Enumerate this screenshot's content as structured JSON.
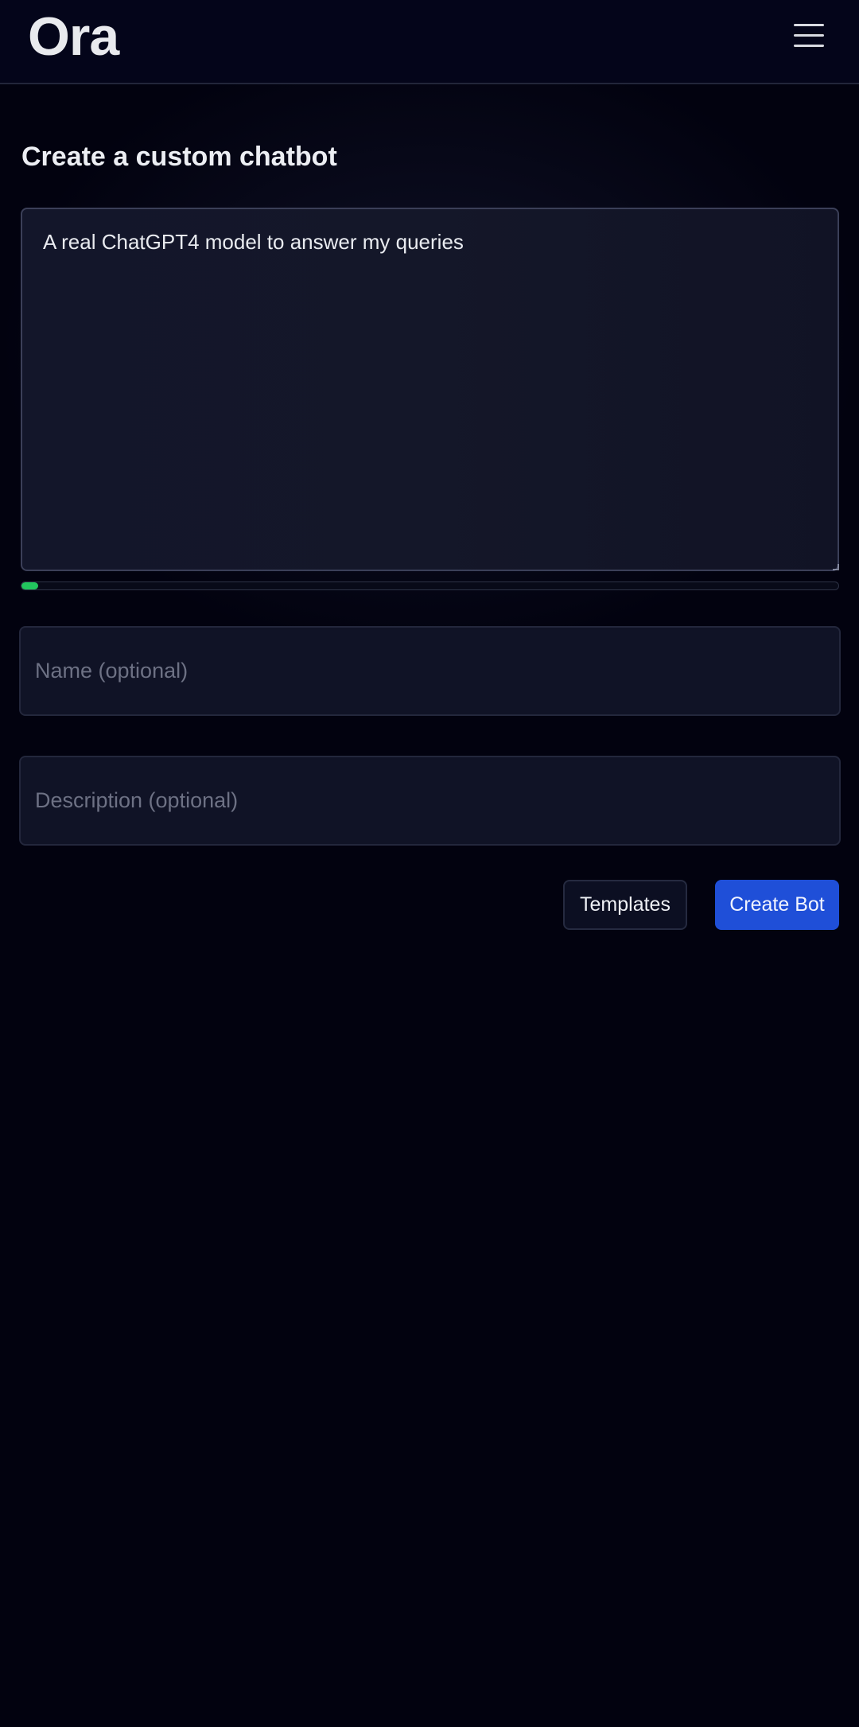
{
  "header": {
    "logo": "Ora",
    "menu_icon": "hamburger-menu-icon"
  },
  "main": {
    "title": "Create a custom chatbot",
    "prompt": {
      "value": "A real ChatGPT4 model to answer my queries"
    },
    "progress": {
      "fraction": 0.02,
      "color": "#22c55e"
    },
    "name_field": {
      "placeholder": "Name (optional)",
      "value": ""
    },
    "description_field": {
      "placeholder": "Description (optional)",
      "value": ""
    },
    "buttons": {
      "templates_label": "Templates",
      "create_label": "Create Bot"
    }
  },
  "colors": {
    "background": "#02020f",
    "accent": "#1f4fd8",
    "progress": "#22c55e"
  }
}
